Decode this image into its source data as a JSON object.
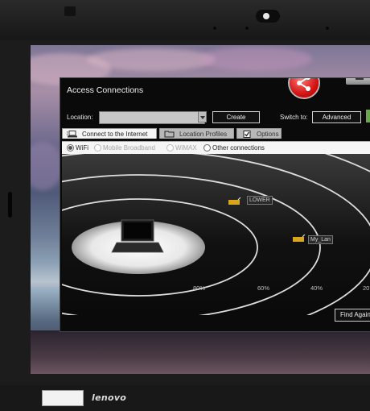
{
  "device": {
    "brand": "lenovo"
  },
  "window": {
    "title": "Access Connections",
    "logo_icon": "access-connections-logo-icon",
    "location_label": "Location:",
    "location_value": "",
    "create_label": "Create",
    "switch_to_label": "Switch to:",
    "advanced_label": "Advanced",
    "tabs": [
      {
        "label": "Connect to the Internet",
        "icon": "laptop-icon",
        "active": true
      },
      {
        "label": "Location Profiles",
        "icon": "folder-icon",
        "active": false
      },
      {
        "label": "Options",
        "icon": "checkbox-icon",
        "active": false
      }
    ],
    "connection_types": [
      {
        "label": "WiFi",
        "selected": true,
        "enabled": true
      },
      {
        "label": "Mobile Broadband",
        "selected": false,
        "enabled": false
      },
      {
        "label": "WiMAX",
        "selected": false,
        "enabled": false
      },
      {
        "label": "Other connections",
        "selected": false,
        "enabled": true
      }
    ],
    "signal_rings": [
      "80%",
      "60%",
      "40%",
      "20"
    ],
    "access_points": [
      {
        "name": "LOWER"
      },
      {
        "name": "My_Lan"
      }
    ],
    "find_again_label": "Find Again"
  },
  "colors": {
    "logo_red": "#d41414",
    "accent_green": "#6ca64a"
  }
}
